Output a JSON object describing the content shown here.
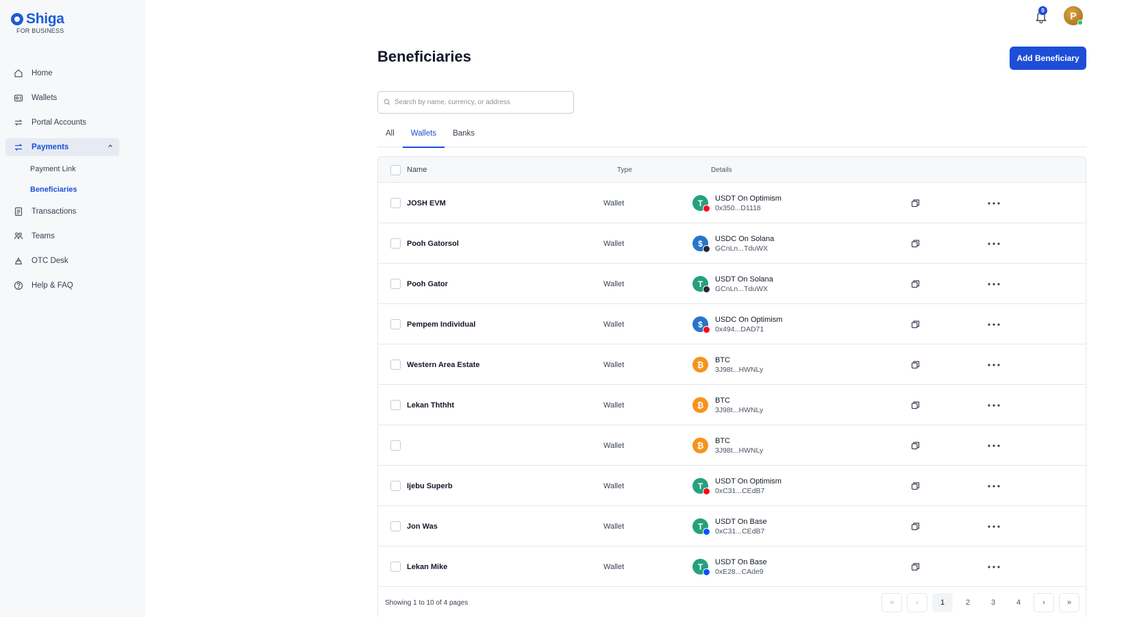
{
  "brand": {
    "name": "Shiga",
    "sub": "FOR BUSINESS"
  },
  "nav": {
    "home": "Home",
    "wallets": "Wallets",
    "portal_accounts": "Portal Accounts",
    "payments": "Payments",
    "payment_link": "Payment Link",
    "beneficiaries": "Beneficiaries",
    "transactions": "Transactions",
    "teams": "Teams",
    "otc_desk": "OTC Desk",
    "help": "Help & FAQ"
  },
  "header": {
    "notifications_count": "0",
    "avatar_initial": "P"
  },
  "page": {
    "title": "Beneficiaries",
    "add_button": "Add Beneficiary",
    "search_placeholder": "Search by name, currency, or address"
  },
  "tabs": [
    "All",
    "Wallets",
    "Banks"
  ],
  "active_tab": "Wallets",
  "table": {
    "headers": {
      "name": "Name",
      "type": "Type",
      "details": "Details"
    },
    "rows": [
      {
        "name": "JOSH EVM",
        "type": "Wallet",
        "asset": "USDT On Optimism",
        "address": "0x350...D1118",
        "coin": "usdt",
        "network": "optimism"
      },
      {
        "name": "Pooh Gatorsol",
        "type": "Wallet",
        "asset": "USDC On Solana",
        "address": "GCnLn...TduWX",
        "coin": "usdc",
        "network": "solana"
      },
      {
        "name": "Pooh Gator",
        "type": "Wallet",
        "asset": "USDT On Solana",
        "address": "GCnLn...TduWX",
        "coin": "usdt",
        "network": "solana"
      },
      {
        "name": "Pempem Individual",
        "type": "Wallet",
        "asset": "USDC On Optimism",
        "address": "0x494...DAD71",
        "coin": "usdc",
        "network": "optimism"
      },
      {
        "name": "Western Area Estate",
        "type": "Wallet",
        "asset": "BTC",
        "address": "3J98t...HWNLy",
        "coin": "btc",
        "network": ""
      },
      {
        "name": "Lekan Ththht",
        "type": "Wallet",
        "asset": "BTC",
        "address": "3J98t...HWNLy",
        "coin": "btc",
        "network": ""
      },
      {
        "name": "",
        "type": "Wallet",
        "asset": "BTC",
        "address": "3J98t...HWNLy",
        "coin": "btc",
        "network": ""
      },
      {
        "name": "Ijebu Superb",
        "type": "Wallet",
        "asset": "USDT On Optimism",
        "address": "0xC31...CEdB7",
        "coin": "usdt",
        "network": "optimism"
      },
      {
        "name": "Jon Was",
        "type": "Wallet",
        "asset": "USDT On Base",
        "address": "0xC31...CEdB7",
        "coin": "usdt",
        "network": "base"
      },
      {
        "name": "Lekan Mike",
        "type": "Wallet",
        "asset": "USDT On Base",
        "address": "0xE28...CAde9",
        "coin": "usdt",
        "network": "base"
      }
    ],
    "showing_text": "Showing 1 to 10 of 4 pages",
    "pager": {
      "first": "«",
      "prev": "‹",
      "pages": [
        "1",
        "2",
        "3",
        "4"
      ],
      "current": "1",
      "next": "›",
      "last": "»"
    }
  },
  "colors": {
    "accent": "#1d4ed8",
    "usdt": "#26a17b",
    "usdc": "#2775ca",
    "btc": "#f7931a",
    "optimism": "#ff0420",
    "solana": "#1f2937",
    "base": "#0052ff"
  }
}
